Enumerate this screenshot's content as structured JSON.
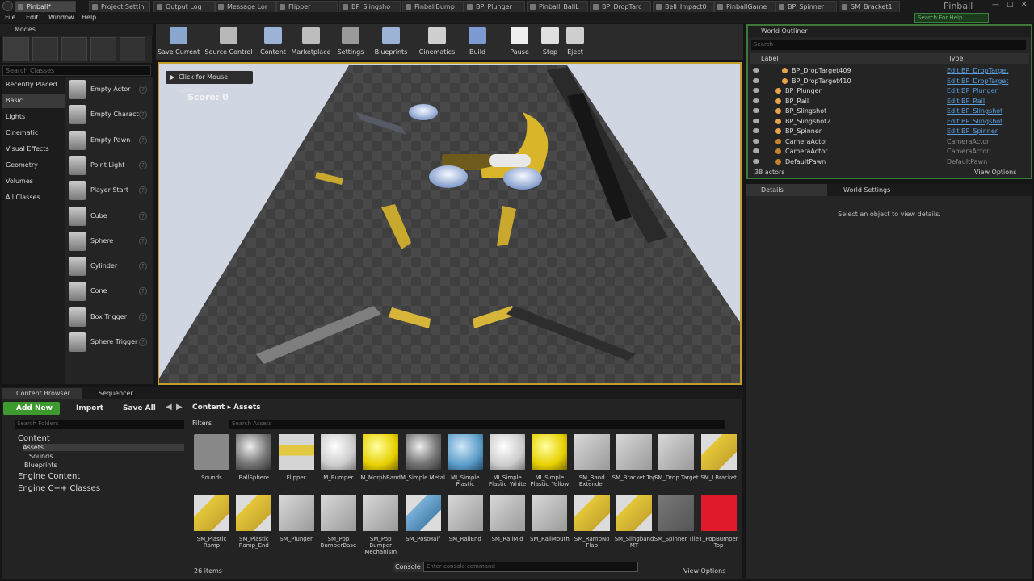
{
  "tabs": [
    {
      "label": "Pinball*",
      "active": true
    },
    {
      "label": "Project Settin",
      "active": false
    },
    {
      "label": "Output Log",
      "active": false
    },
    {
      "label": "Message Lor",
      "active": false
    },
    {
      "label": "Flipper",
      "active": false
    },
    {
      "label": "BP_Slingsho",
      "active": false
    },
    {
      "label": "PinballBump",
      "active": false
    },
    {
      "label": "BP_Plunger",
      "active": false
    },
    {
      "label": "Pinball_BallL",
      "active": false
    },
    {
      "label": "BP_DropTarc",
      "active": false
    },
    {
      "label": "Bell_Impact0",
      "active": false
    },
    {
      "label": "PinballGame",
      "active": false
    },
    {
      "label": "BP_Spinner",
      "active": false
    },
    {
      "label": "SM_Bracket1",
      "active": false
    }
  ],
  "project_name": "Pinball",
  "search_help": "Search For Help",
  "menu": [
    "File",
    "Edit",
    "Window",
    "Help"
  ],
  "modes": {
    "title": "Modes",
    "search_placeholder": "Search Classes",
    "categories": [
      "Recently Placed",
      "Basic",
      "Lights",
      "Cinematic",
      "Visual Effects",
      "Geometry",
      "Volumes",
      "All Classes"
    ],
    "selected_category": "Basic",
    "items": [
      "Empty Actor",
      "Empty Charact",
      "Empty Pawn",
      "Point Light",
      "Player Start",
      "Cube",
      "Sphere",
      "Cylinder",
      "Cone",
      "Box Trigger",
      "Sphere Trigger"
    ]
  },
  "toolbar": [
    {
      "label": "Save Current",
      "icon": "save-icon"
    },
    {
      "label": "Source Control",
      "icon": "source-control-icon"
    },
    {
      "label": "Content",
      "icon": "content-icon"
    },
    {
      "label": "Marketplace",
      "icon": "marketplace-icon"
    },
    {
      "label": "Settings",
      "icon": "settings-icon"
    },
    {
      "label": "Blueprints",
      "icon": "blueprints-icon"
    },
    {
      "label": "Cinematics",
      "icon": "cinematics-icon"
    },
    {
      "label": "Build",
      "icon": "build-icon"
    },
    {
      "label": "Pause",
      "icon": "pause-icon"
    },
    {
      "label": "Stop",
      "icon": "stop-icon"
    },
    {
      "label": "Eject",
      "icon": "eject-icon"
    }
  ],
  "viewport": {
    "mouse_control": "Click for Mouse Control",
    "score": "Score: 0",
    "accent": "#c59d2a"
  },
  "outliner": {
    "title": "World Outliner",
    "search_placeholder": "Search",
    "col_label": "Label",
    "col_type": "Type",
    "rows": [
      {
        "name": "BP_DropTarget409",
        "type": "Edit BP_DropTarget",
        "link": true
      },
      {
        "name": "BP_DropTarget410",
        "type": "Edit BP_DropTarget",
        "link": true
      },
      {
        "name": "BP_Plunger",
        "type": "Edit BP_Plunger",
        "link": true
      },
      {
        "name": "BP_Rail",
        "type": "Edit BP_Rail",
        "link": true
      },
      {
        "name": "BP_Slingshot",
        "type": "Edit BP_Slingshot",
        "link": true
      },
      {
        "name": "BP_Slingshot2",
        "type": "Edit BP_Slingshot",
        "link": true
      },
      {
        "name": "BP_Spinner",
        "type": "Edit BP_Spinner",
        "link": true
      },
      {
        "name": "CameraActor",
        "type": "CameraActor",
        "link": false
      },
      {
        "name": "CameraActor",
        "type": "CameraActor",
        "link": false
      },
      {
        "name": "DefaultPawn",
        "type": "DefaultPawn",
        "link": false
      }
    ],
    "actors": "38 actors",
    "view_options": "View Options"
  },
  "details": {
    "tab_details": "Details",
    "tab_world": "World Settings",
    "message": "Select an object to view details."
  },
  "content_browser": {
    "tab_cb": "Content Browser",
    "tab_seq": "Sequencer",
    "add_new": "Add New",
    "import": "Import",
    "save_all": "Save All",
    "crumb_root": "Content",
    "crumb_sub": "Assets",
    "search_folders": "Search Folders",
    "filters": "Filters",
    "search_assets": "Search Assets",
    "tree": {
      "content": "Content",
      "assets": "Assets",
      "sounds": "Sounds",
      "blueprints": "Blueprints",
      "engine": "Engine Content",
      "engine_cpp": "Engine C++ Classes"
    },
    "assets": [
      {
        "label": "Sounds",
        "kind": "folder"
      },
      {
        "label": "BallSphere",
        "kind": "sphere-grey"
      },
      {
        "label": "Flipper",
        "kind": "yellow-bar"
      },
      {
        "label": "M_Bumper",
        "kind": "sphere-white"
      },
      {
        "label": "M_MorphBand",
        "kind": "sphere-yellow"
      },
      {
        "label": "M_Simple Metal",
        "kind": "sphere-grey"
      },
      {
        "label": "MI_Simple Plastic",
        "kind": "sphere-blue"
      },
      {
        "label": "MI_Simple Plastic_White",
        "kind": "sphere-white"
      },
      {
        "label": "MI_Simple Plastic_Yellow",
        "kind": "sphere-yellow"
      },
      {
        "label": "SM_Band Extender",
        "kind": "mesh"
      },
      {
        "label": "SM_Bracket Top",
        "kind": "mesh"
      },
      {
        "label": "SM_Drop Target",
        "kind": "mesh"
      },
      {
        "label": "SM_LBracket",
        "kind": "mesh-yellow"
      },
      {
        "label": "SM_Plastic Ramp",
        "kind": "mesh-yellow"
      },
      {
        "label": "SM_Plastic Ramp_End",
        "kind": "mesh-yellow"
      },
      {
        "label": "SM_Plunger",
        "kind": "mesh"
      },
      {
        "label": "SM_Pop BumperBase",
        "kind": "mesh"
      },
      {
        "label": "SM_Pop Bumper Mechanism",
        "kind": "mesh"
      },
      {
        "label": "SM_PostHalf",
        "kind": "mesh-blue"
      },
      {
        "label": "SM_RailEnd",
        "kind": "mesh"
      },
      {
        "label": "SM_RailMid",
        "kind": "mesh"
      },
      {
        "label": "SM_RailMouth",
        "kind": "mesh"
      },
      {
        "label": "SM_RampNo Flap",
        "kind": "mesh-yellow"
      },
      {
        "label": "SM_Slingband MT",
        "kind": "mesh-yellow"
      },
      {
        "label": "SM_Spinner Tile",
        "kind": "mesh-grey"
      },
      {
        "label": "T_PopBumper Top",
        "kind": "texture-red"
      }
    ],
    "items_count": "26 items",
    "console_label": "Console",
    "console_placeholder": "Enter console command",
    "view_options": "View Options"
  }
}
